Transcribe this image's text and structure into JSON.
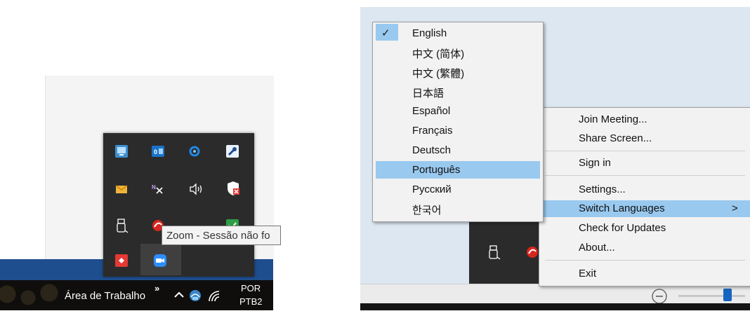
{
  "taskbar": {
    "desktop_label": "Área de Trabalho",
    "overflow_chevrons": "»",
    "lang_line1": "POR",
    "lang_line2": "PTB2"
  },
  "tooltip": {
    "text": "Zoom - Sessão não fo"
  },
  "language_menu": {
    "checkmark": "✓",
    "items": [
      "English",
      "中文 (简体)",
      "中文 (繁體)",
      "日本語",
      "Español",
      "Français",
      "Deutsch",
      "Português",
      "Русский",
      "한국어"
    ],
    "checked": "English",
    "highlighted": "Português"
  },
  "context_menu": {
    "items": [
      "Join Meeting...",
      "Share Screen...",
      "Sign in",
      "Settings...",
      "Switch Languages",
      "Check for Updates",
      "About...",
      "Exit"
    ],
    "submenu_arrow": ">",
    "highlighted": "Switch Languages"
  },
  "icons": {
    "tray": [
      "monitor-icon",
      "outlook-icon",
      "sync-icon",
      "tool-icon",
      "mail-icon",
      "onenote-icon",
      "volume-icon",
      "security-icon",
      "usb-drive-icon",
      "red-circle-app-icon",
      "app-icon",
      "check-app-icon",
      "red-app-icon",
      "zoom-icon"
    ]
  },
  "colors": {
    "tray_bg": "#2b2b2b",
    "menu_highlight": "#99c9ef",
    "taskbar_blue": "#1f4e8f"
  }
}
